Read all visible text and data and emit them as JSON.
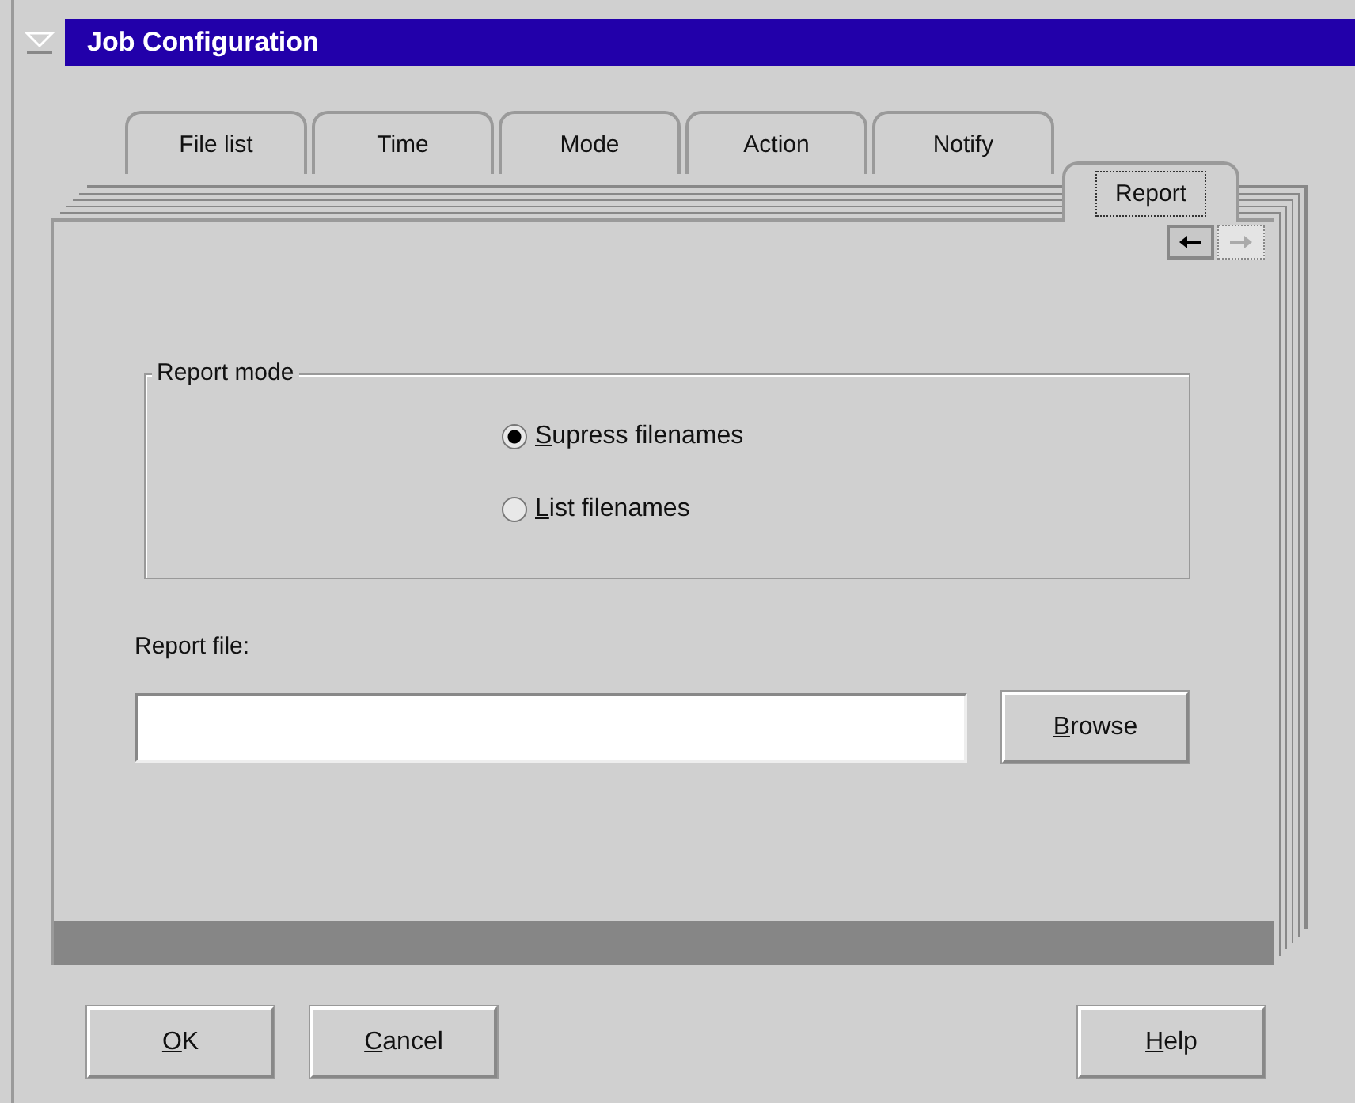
{
  "window": {
    "title": "Job Configuration"
  },
  "tabs": [
    {
      "label": "File list",
      "selected": false
    },
    {
      "label": "Time",
      "selected": false
    },
    {
      "label": "Mode",
      "selected": false
    },
    {
      "label": "Action",
      "selected": false
    },
    {
      "label": "Notify",
      "selected": false
    },
    {
      "label": "Report",
      "selected": true
    }
  ],
  "page_arrows": [
    {
      "kind": "left",
      "disabled": false
    },
    {
      "kind": "right",
      "disabled": true
    }
  ],
  "report_mode": {
    "title": "Report mode",
    "options": [
      {
        "label": "Supress filenames",
        "selected": true,
        "mnemonic": true
      },
      {
        "label": "List filenames",
        "selected": false,
        "mnemonic": true
      }
    ]
  },
  "report_file": {
    "label": "Report file:",
    "button": {
      "label": "Browse",
      "mnemonic": true
    }
  },
  "buttons": [
    {
      "label": "OK",
      "mnemonic": true
    },
    {
      "label": "Cancel",
      "mnemonic": true
    }
  ],
  "help_button": {
    "label": "Help",
    "mnemonic": true
  }
}
